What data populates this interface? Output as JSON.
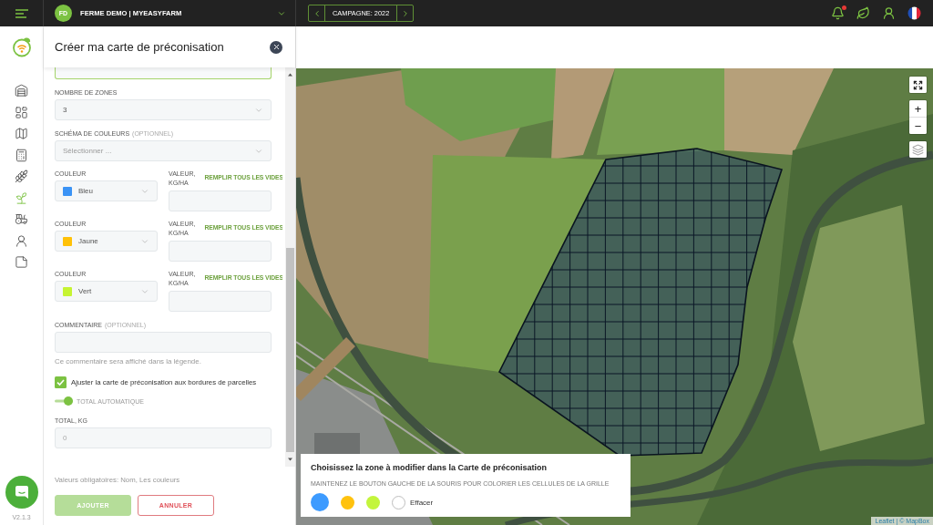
{
  "topbar": {
    "farm": {
      "initials": "FD",
      "name": "FERME DEMO | MYEASYFARM"
    },
    "campaign": "CAMPAGNE: 2022",
    "notifications": {
      "unread": true
    }
  },
  "sidebar": {
    "items": [
      {
        "selected": false
      },
      {
        "selected": false
      },
      {
        "selected": false
      },
      {
        "selected": false
      },
      {
        "selected": false
      },
      {
        "selected": true
      },
      {
        "selected": false
      },
      {
        "selected": false
      },
      {
        "selected": false
      }
    ],
    "version": "V2.1.3"
  },
  "panel": {
    "title": "Créer ma carte de préconisation",
    "zones": {
      "label": "NOMBRE DE ZONES",
      "value": "3"
    },
    "color_scheme": {
      "label": "SCHÉMA DE COULEURS",
      "optional": "(OPTIONNEL)",
      "placeholder": "Sélectionner ..."
    },
    "color_rows": [
      {
        "color_label": "COULEUR",
        "color_name": "Bleu",
        "color": "#3b93f5",
        "value_label": "VALEUR, KG/HA",
        "fill_link": "REMPLIR TOUS LES VIDES"
      },
      {
        "color_label": "COULEUR",
        "color_name": "Jaune",
        "color": "#ffc107",
        "value_label": "VALEUR, KG/HA",
        "fill_link": "REMPLIR TOUS LES VIDES"
      },
      {
        "color_label": "COULEUR",
        "color_name": "Vert",
        "color": "#c6f432",
        "value_label": "VALEUR, KG/HA",
        "fill_link": "REMPLIR TOUS LES VIDES"
      }
    ],
    "comment": {
      "label": "COMMENTAIRE",
      "optional": "(OPTIONNEL)",
      "hint": "Ce commentaire sera affiché dans la légende."
    },
    "adjust": {
      "label": "Ajuster la carte de préconisation aux bordures de parcelles",
      "checked": true
    },
    "auto_total": {
      "label": "TOTAL AUTOMATIQUE",
      "on": true
    },
    "total": {
      "label": "TOTAL, KG",
      "value": "0",
      "disabled": true
    },
    "required_note": "Valeurs obligatoires: Nom, Les couleurs",
    "buttons": [
      {
        "label": "AJOUTER",
        "kind": "submit",
        "disabled": true
      },
      {
        "label": "ANNULER",
        "kind": "cancel",
        "disabled": false
      }
    ]
  },
  "map": {
    "zoom_in": "+",
    "zoom_out": "−",
    "zone_picker": {
      "title": "Choisissez la zone à modifier dans la Carte de préconisation",
      "hint": "MAINTENEZ LE BOUTON GAUCHE DE LA SOURIS POUR COLORIER LES CELLULES DE LA GRILLE",
      "swatches": [
        {
          "color": "#3d9bff",
          "selected": true
        },
        {
          "color": "#ffc20e",
          "selected": false
        },
        {
          "color": "#c3f53c",
          "selected": false
        }
      ],
      "eraser": {
        "label": "Effacer",
        "selected": false
      }
    },
    "attribution": "Leaflet | © MapBox"
  }
}
